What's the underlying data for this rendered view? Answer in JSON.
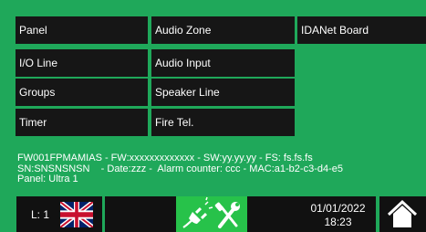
{
  "menu": {
    "panel": "Panel",
    "audio_zone": "Audio Zone",
    "idanet_board": "IDANet Board",
    "io_line": "I/O Line",
    "audio_input": "Audio Input",
    "groups": "Groups",
    "speaker_line": "Speaker Line",
    "timer": "Timer",
    "fire_tel": "Fire Tel."
  },
  "info": {
    "line1": "FW001FPMAMIAS - FW:xxxxxxxxxxxxx - SW:yy.yy.yy - FS: fs.fs.fs",
    "line2": "SN:SNSNSNSN    - Date:zzz -  Alarm counter: ccc - MAC:a1-b2-c3-d4-e5",
    "line3": "Panel: Ultra 1"
  },
  "footer": {
    "level": "L: 1",
    "language_icon": "uk-flag-icon",
    "service_icon": "plug-and-tools-icon",
    "home_icon": "home-icon",
    "date": "01/01/2022",
    "time": "18:23"
  },
  "colors": {
    "background": "#1fa85a",
    "button": "#161616",
    "service": "#27c24a",
    "text": "#ffffff"
  }
}
